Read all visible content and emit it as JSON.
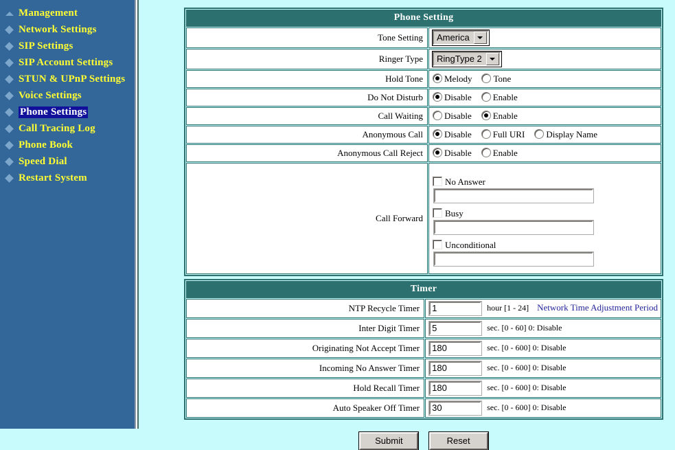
{
  "sidebar": {
    "items": [
      {
        "label": "Management",
        "icon": "triangle-bullet-icon",
        "selected": false
      },
      {
        "label": "Network Settings",
        "icon": "diamond-bullet-icon",
        "selected": false
      },
      {
        "label": "SIP Settings",
        "icon": "diamond-bullet-icon",
        "selected": false
      },
      {
        "label": "SIP Account Settings",
        "icon": "diamond-bullet-icon",
        "selected": false
      },
      {
        "label": "STUN & UPnP Settings",
        "icon": "diamond-bullet-icon",
        "selected": false
      },
      {
        "label": "Voice Settings",
        "icon": "diamond-bullet-icon",
        "selected": false
      },
      {
        "label": "Phone Settings",
        "icon": "diamond-bullet-icon",
        "selected": true
      },
      {
        "label": "Call Tracing Log",
        "icon": "diamond-bullet-icon",
        "selected": false
      },
      {
        "label": "Phone Book",
        "icon": "diamond-bullet-icon",
        "selected": false
      },
      {
        "label": "Speed Dial",
        "icon": "diamond-bullet-icon",
        "selected": false
      },
      {
        "label": "Restart System",
        "icon": "diamond-bullet-icon",
        "selected": false
      }
    ]
  },
  "phone_setting": {
    "header": "Phone Setting",
    "tone_setting": {
      "label": "Tone Setting",
      "value": "America"
    },
    "ringer_type": {
      "label": "Ringer Type",
      "value": "RingType 2"
    },
    "hold_tone": {
      "label": "Hold Tone",
      "options": [
        {
          "label": "Melody",
          "checked": true
        },
        {
          "label": "Tone",
          "checked": false
        }
      ]
    },
    "do_not_disturb": {
      "label": "Do Not Disturb",
      "options": [
        {
          "label": "Disable",
          "checked": true
        },
        {
          "label": "Enable",
          "checked": false
        }
      ]
    },
    "call_waiting": {
      "label": "Call Waiting",
      "options": [
        {
          "label": "Disable",
          "checked": false
        },
        {
          "label": "Enable",
          "checked": true
        }
      ]
    },
    "anonymous_call": {
      "label": "Anonymous Call",
      "options": [
        {
          "label": "Disable",
          "checked": true
        },
        {
          "label": "Full URI",
          "checked": false
        },
        {
          "label": "Display Name",
          "checked": false
        }
      ]
    },
    "anonymous_call_reject": {
      "label": "Anonymous Call Reject",
      "options": [
        {
          "label": "Disable",
          "checked": true
        },
        {
          "label": "Enable",
          "checked": false
        }
      ]
    },
    "call_forward": {
      "label": "Call Forward",
      "entries": [
        {
          "label": "No Answer",
          "checked": false,
          "value": ""
        },
        {
          "label": "Busy",
          "checked": false,
          "value": ""
        },
        {
          "label": "Unconditional",
          "checked": false,
          "value": ""
        }
      ]
    }
  },
  "timer": {
    "header": "Timer",
    "rows": [
      {
        "label": "NTP Recycle Timer",
        "value": "1",
        "hint": "hour [1 - 24]",
        "link": "Network Time Adjustment Period"
      },
      {
        "label": "Inter Digit Timer",
        "value": "5",
        "hint": "sec. [0 - 60] 0: Disable",
        "link": ""
      },
      {
        "label": "Originating Not Accept Timer",
        "value": "180",
        "hint": "sec. [0 - 600] 0: Disable",
        "link": ""
      },
      {
        "label": "Incoming No Answer Timer",
        "value": "180",
        "hint": "sec. [0 - 600] 0: Disable",
        "link": ""
      },
      {
        "label": "Hold Recall Timer",
        "value": "180",
        "hint": "sec. [0 - 600] 0: Disable",
        "link": ""
      },
      {
        "label": "Auto Speaker Off Timer",
        "value": "30",
        "hint": "sec. [0 - 600] 0: Disable",
        "link": ""
      }
    ]
  },
  "buttons": {
    "submit": "Submit",
    "reset": "Reset"
  },
  "colors": {
    "sidebar_bg": "#336699",
    "sidebar_link": "#ffff33",
    "sidebar_selected_bg": "#10109a",
    "content_bg": "#c8fcfc",
    "section_header_bg": "#2d7070",
    "border": "#2d7070",
    "hint_link": "#24249a"
  }
}
